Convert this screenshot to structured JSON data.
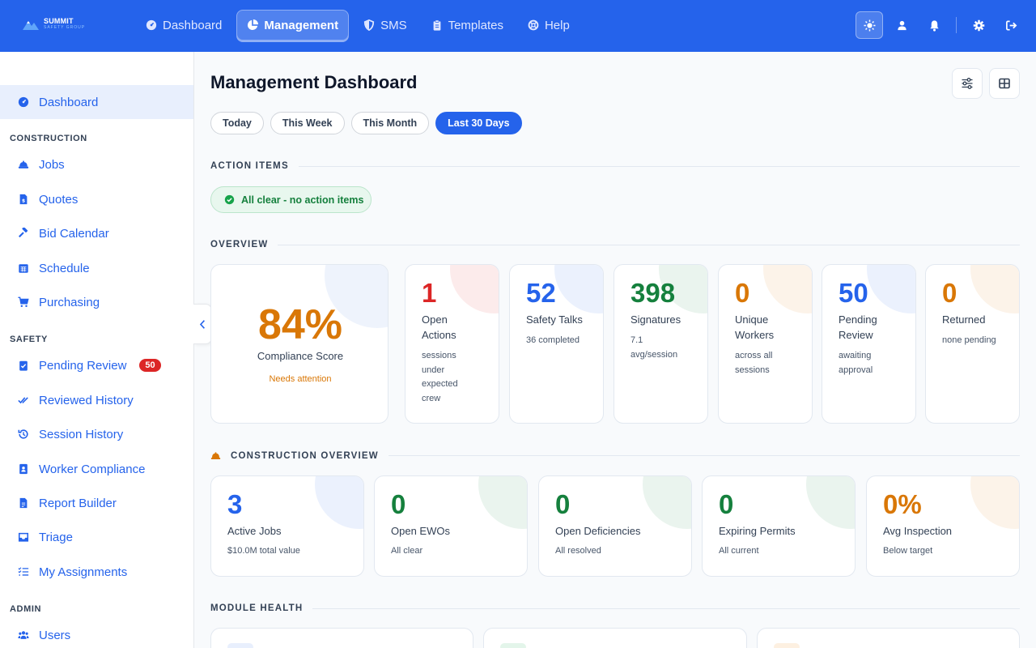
{
  "brand": {
    "name": "SUMMIT",
    "tagline": "SAFETY GROUP"
  },
  "topnav": [
    {
      "label": "Dashboard",
      "icon": "gauge-icon"
    },
    {
      "label": "Management",
      "icon": "pie-chart-icon",
      "active": true
    },
    {
      "label": "SMS",
      "icon": "shield-icon"
    },
    {
      "label": "Templates",
      "icon": "clipboard-icon"
    },
    {
      "label": "Help",
      "icon": "lifebuoy-icon"
    }
  ],
  "sidebar": {
    "dashboard": "Dashboard",
    "sections": {
      "construction": "CONSTRUCTION",
      "safety": "SAFETY",
      "admin": "ADMIN"
    },
    "construction": [
      "Jobs",
      "Quotes",
      "Bid Calendar",
      "Schedule",
      "Purchasing"
    ],
    "safety": [
      "Pending Review",
      "Reviewed History",
      "Session History",
      "Worker Compliance",
      "Report Builder",
      "Triage",
      "My Assignments"
    ],
    "pending_badge": "50",
    "admin": [
      "Users"
    ]
  },
  "page": {
    "title": "Management Dashboard"
  },
  "filters": [
    "Today",
    "This Week",
    "This Month",
    "Last 30 Days"
  ],
  "active_filter": "Last 30 Days",
  "sections": {
    "action_items": "ACTION ITEMS",
    "overview": "OVERVIEW",
    "construction_overview": "CONSTRUCTION OVERVIEW",
    "module_health": "MODULE HEALTH"
  },
  "action_status": "All clear - no action items",
  "compliance": {
    "value": "84%",
    "label": "Compliance Score",
    "note": "Needs attention"
  },
  "overview_cards": [
    {
      "value": "1",
      "label_lines": [
        "Open",
        "Actions"
      ],
      "sub_lines": [
        "sessions",
        "under",
        "expected",
        "crew"
      ],
      "color": "#dc2626"
    },
    {
      "value": "52",
      "label_lines": [
        "Safety Talks"
      ],
      "sub_lines": [
        "36 completed"
      ],
      "color": "#2563eb"
    },
    {
      "value": "398",
      "label_lines": [
        "Signatures"
      ],
      "sub_lines": [
        "7.1",
        "avg/session"
      ],
      "color": "#15803d"
    },
    {
      "value": "0",
      "label_lines": [
        "Unique",
        "Workers"
      ],
      "sub_lines": [
        "across all",
        "sessions"
      ],
      "color": "#d97706"
    },
    {
      "value": "50",
      "label_lines": [
        "Pending",
        "Review"
      ],
      "sub_lines": [
        "awaiting",
        "approval"
      ],
      "color": "#2563eb"
    },
    {
      "value": "0",
      "label_lines": [
        "Returned"
      ],
      "sub_lines": [
        "none pending"
      ],
      "color": "#d97706"
    }
  ],
  "construction_cards": [
    {
      "value": "3",
      "label": "Active Jobs",
      "sub": "$10.0M total value",
      "color": "#2563eb"
    },
    {
      "value": "0",
      "label": "Open EWOs",
      "sub": "All clear",
      "color": "#15803d"
    },
    {
      "value": "0",
      "label": "Open Deficiencies",
      "sub": "All resolved",
      "color": "#15803d"
    },
    {
      "value": "0",
      "label": "Expiring Permits",
      "sub": "All current",
      "color": "#15803d"
    },
    {
      "value": "0%",
      "label": "Avg Inspection",
      "sub": "Below target",
      "color": "#d97706"
    }
  ]
}
